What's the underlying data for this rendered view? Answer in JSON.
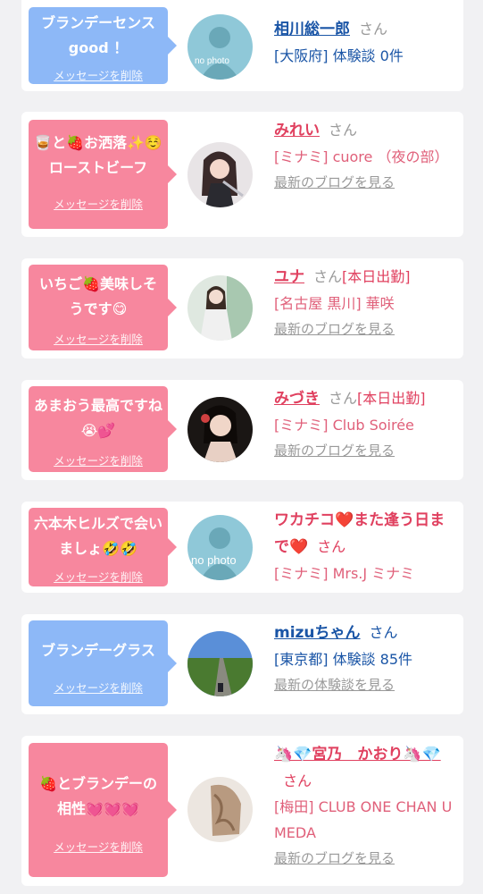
{
  "entries": [
    {
      "message": "ブランデーセンス good ！",
      "delete_label": "メッセージを削除",
      "name": "相川総一郎",
      "name_suffix": "さん",
      "extra": "",
      "location": "[大阪府] 体験談 0件",
      "blog_link": ""
    },
    {
      "message": "🥃と🍓お洒落✨☺️ローストビーフ",
      "delete_label": "メッセージを削除",
      "name": "みれい",
      "name_suffix": "さん",
      "extra": "",
      "location": "[ミナミ] cuore （夜の部）",
      "blog_link": "最新のブログを見る"
    },
    {
      "message": "いちご🍓美味しそうです😋",
      "delete_label": "メッセージを削除",
      "name": "ユナ",
      "name_suffix": "さん",
      "extra": "[本日出勤]",
      "location": "[名古屋 黒川] 華咲",
      "blog_link": "最新のブログを見る"
    },
    {
      "message": "あまおう最高ですね😭💕",
      "delete_label": "メッセージを削除",
      "name": "みづき",
      "name_suffix": "さん",
      "extra": "[本日出勤]",
      "location": "[ミナミ] Club Soirée",
      "blog_link": "最新のブログを見る"
    },
    {
      "message": "六本木ヒルズで会いましょ🤣🤣",
      "delete_label": "メッセージを削除",
      "name": "ワカチコ❤️また逢う日まで❤️",
      "name_suffix": "さん",
      "extra": "",
      "location": "[ミナミ] Mrs.J ミナミ",
      "blog_link": ""
    },
    {
      "message": "ブランデーグラス",
      "delete_label": "メッセージを削除",
      "name": "mizuちゃん",
      "name_suffix": "さん",
      "extra": "",
      "location": "[東京都] 体験談 85件",
      "blog_link": "最新の体験談を見る"
    },
    {
      "message": "🍓とブランデーの相性💓💓💓",
      "delete_label": "メッセージを削除",
      "name": "🦄💎宮乃　かおり🦄💎",
      "name_suffix": "さん",
      "extra": "",
      "location": "[梅田] CLUB ONE CHAN UMEDA",
      "blog_link": "最新のブログを見る"
    }
  ],
  "no_photo_label": "no photo",
  "colors": {
    "pink_bubble": "#f7879e",
    "blue_bubble": "#8db8f7",
    "pink_text": "#e0405f",
    "blue_text": "#1a55a6",
    "muted": "#999999"
  }
}
